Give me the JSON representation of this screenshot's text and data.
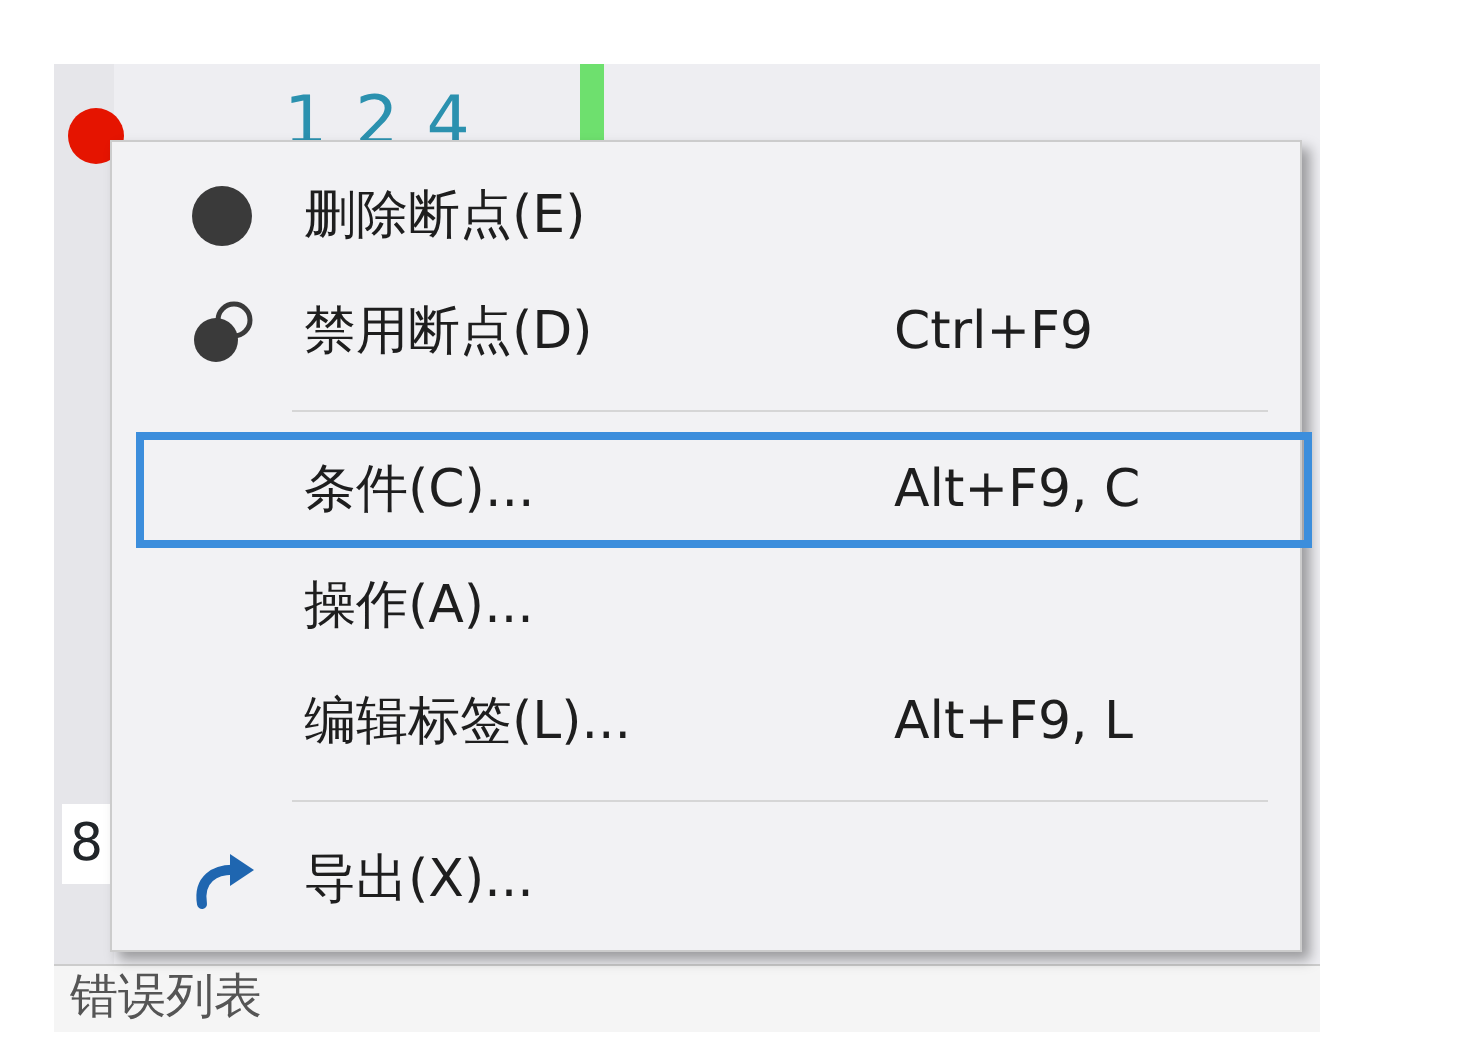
{
  "editor": {
    "line_number": "124",
    "breakpoint": true,
    "side_text": "8",
    "bottom_panel_title": "错误列表"
  },
  "context_menu": {
    "items": [
      {
        "kind": "dot",
        "label": "删除断点(E)",
        "selected": false
      },
      {
        "kind": "ring",
        "label": "禁用断点(D)",
        "shortcut": "Ctrl+F9",
        "selected": false
      },
      {
        "kind": "separator"
      },
      {
        "kind": "plain",
        "label": "条件(C)...",
        "shortcut": "Alt+F9, C",
        "selected": true
      },
      {
        "kind": "plain",
        "label": "操作(A)...",
        "selected": false
      },
      {
        "kind": "plain",
        "label": "编辑标签(L)...",
        "shortcut": "Alt+F9, L",
        "selected": false
      },
      {
        "kind": "separator"
      },
      {
        "kind": "arrow",
        "label": "导出(X)...",
        "selected": false
      }
    ]
  }
}
